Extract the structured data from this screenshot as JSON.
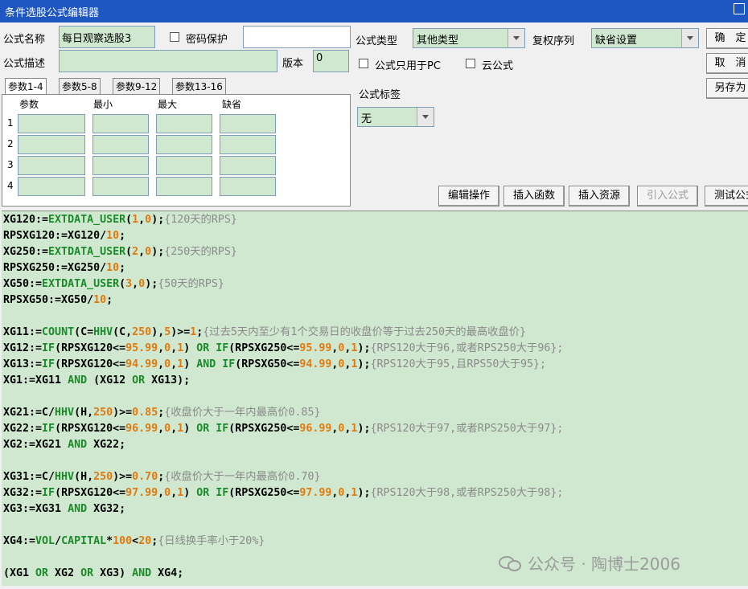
{
  "window": {
    "title": "条件选股公式编辑器"
  },
  "form": {
    "name_label": "公式名称",
    "name_value": "每日观察选股3",
    "password_label": "密码保护",
    "password_value": "",
    "desc_label": "公式描述",
    "desc_value": "",
    "version_label": "版本",
    "version_value": "0",
    "type_label": "公式类型",
    "type_value": "其他类型",
    "restore_label": "复权序列",
    "restore_value": "缺省设置",
    "pc_only_label": "公式只用于PC",
    "cloud_label": "云公式",
    "tag_label": "公式标签",
    "tag_value": "无"
  },
  "side_buttons": {
    "ok": "确　定",
    "cancel": "取　消",
    "save_as": "另存为"
  },
  "params": {
    "tabs": [
      "参数1-4",
      "参数5-8",
      "参数9-12",
      "参数13-16"
    ],
    "headers": [
      "参数",
      "最小",
      "最大",
      "缺省"
    ],
    "rows": [
      "1",
      "2",
      "3",
      "4"
    ]
  },
  "toolbar": {
    "edit_op": "编辑操作",
    "insert_func": "插入函数",
    "insert_res": "插入资源",
    "import_formula": "引入公式",
    "test_formula": "测试公式"
  },
  "code": {
    "l1a": "XG120:=",
    "l1b": "EXTDATA_USER",
    "l1c": "(",
    "l1d": "1",
    "l1e": ",",
    "l1f": "0",
    "l1g": ");",
    "l1h": "{120天的RPS}",
    "l2a": "RPSXG120:=XG120/",
    "l2b": "10",
    "l2c": ";",
    "l3a": "XG250:=",
    "l3b": "EXTDATA_USER",
    "l3c": "(",
    "l3d": "2",
    "l3e": ",",
    "l3f": "0",
    "l3g": ");",
    "l3h": "{250天的RPS}",
    "l4a": "RPSXG250:=XG250/",
    "l4b": "10",
    "l4c": ";",
    "l5a": "XG50:=",
    "l5b": "EXTDATA_USER",
    "l5c": "(",
    "l5d": "3",
    "l5e": ",",
    "l5f": "0",
    "l5g": ");",
    "l5h": "{50天的RPS}",
    "l6a": "RPSXG50:=XG50/",
    "l6b": "10",
    "l6c": ";",
    "l7a": "XG11:=",
    "l7b": "COUNT",
    "l7c": "(C=",
    "l7d": "HHV",
    "l7e": "(C,",
    "l7f": "250",
    "l7g": "),",
    "l7h": "5",
    "l7i": ")>=",
    "l7j": "1",
    "l7k": ";",
    "l7l": "{过去5天内至少有1个交易日的收盘价等于过去250天的最高收盘价}",
    "l8a": "XG12:=",
    "l8b": "IF",
    "l8c": "(RPSXG120<=",
    "l8d": "95.99",
    "l8e": ",",
    "l8f": "0",
    "l8g": ",",
    "l8h": "1",
    "l8i": ") ",
    "l8j": "OR",
    "l8k": " ",
    "l8l": "IF",
    "l8m": "(RPSXG250<=",
    "l8n": "95.99",
    "l8o": ",",
    "l8p": "0",
    "l8q": ",",
    "l8r": "1",
    "l8s": ");",
    "l8t": "{RPS120大于96,或者RPS250大于96};",
    "l9a": "XG13:=",
    "l9b": "IF",
    "l9c": "(RPSXG120<=",
    "l9d": "94.99",
    "l9e": ",",
    "l9f": "0",
    "l9g": ",",
    "l9h": "1",
    "l9i": ") ",
    "l9j": "AND",
    "l9k": " ",
    "l9l": "IF",
    "l9m": "(RPSXG50<=",
    "l9n": "94.99",
    "l9o": ",",
    "l9p": "0",
    "l9q": ",",
    "l9r": "1",
    "l9s": ");",
    "l9t": "{RPS120大于95,且RPS50大于95};",
    "l10a": "XG1:=XG11 ",
    "l10b": "AND",
    "l10c": " (XG12 ",
    "l10d": "OR",
    "l10e": " XG13);",
    "l11a": "XG21:=C/",
    "l11b": "HHV",
    "l11c": "(H,",
    "l11d": "250",
    "l11e": ")>=",
    "l11f": "0.85",
    "l11g": ";",
    "l11h": "{收盘价大于一年内最高价0.85}",
    "l12a": "XG22:=",
    "l12b": "IF",
    "l12c": "(RPSXG120<=",
    "l12d": "96.99",
    "l12e": ",",
    "l12f": "0",
    "l12g": ",",
    "l12h": "1",
    "l12i": ") ",
    "l12j": "OR",
    "l12k": " ",
    "l12l": "IF",
    "l12m": "(RPSXG250<=",
    "l12n": "96.99",
    "l12o": ",",
    "l12p": "0",
    "l12q": ",",
    "l12r": "1",
    "l12s": ");",
    "l12t": "{RPS120大于97,或者RPS250大于97};",
    "l13a": "XG2:=XG21 ",
    "l13b": "AND",
    "l13c": " XG22;",
    "l14a": "XG31:=C/",
    "l14b": "HHV",
    "l14c": "(H,",
    "l14d": "250",
    "l14e": ")>=",
    "l14f": "0.70",
    "l14g": ";",
    "l14h": "{收盘价大于一年内最高价0.70}",
    "l15a": "XG32:=",
    "l15b": "IF",
    "l15c": "(RPSXG120<=",
    "l15d": "97.99",
    "l15e": ",",
    "l15f": "0",
    "l15g": ",",
    "l15h": "1",
    "l15i": ") ",
    "l15j": "OR",
    "l15k": " ",
    "l15l": "IF",
    "l15m": "(RPSXG250<=",
    "l15n": "97.99",
    "l15o": ",",
    "l15p": "0",
    "l15q": ",",
    "l15r": "1",
    "l15s": ");",
    "l15t": "{RPS120大于98,或者RPS250大于98};",
    "l16a": "XG3:=XG31 ",
    "l16b": "AND",
    "l16c": " XG32;",
    "l17a": "XG4:=",
    "l17b": "VOL",
    "l17c": "/",
    "l17d": "CAPITAL",
    "l17e": "*",
    "l17f": "100",
    "l17g": "<",
    "l17h": "20",
    "l17i": ";",
    "l17j": "{日线换手率小于20%}",
    "l18a": "(XG1 ",
    "l18b": "OR",
    "l18c": " XG2 ",
    "l18d": "OR",
    "l18e": " XG3) ",
    "l18f": "AND",
    "l18g": " XG4;"
  },
  "watermark": "公众号 · 陶博士2006"
}
